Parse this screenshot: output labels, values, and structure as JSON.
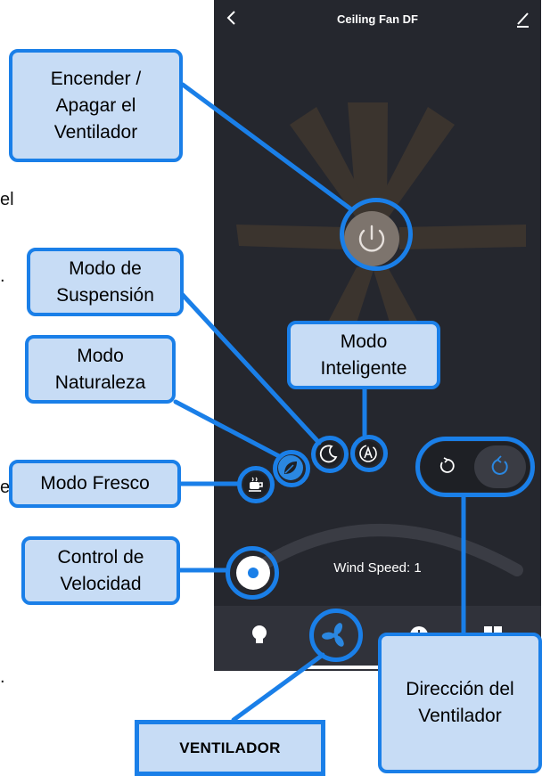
{
  "app": {
    "title": "Ceiling Fan DF",
    "wind_speed_text": "Wind Speed: 1"
  },
  "page_edge_fragments": {
    "el": "el",
    "dot": ".",
    "e": "e",
    "dot2": "."
  },
  "callouts": {
    "power": [
      "Encender /",
      "Apagar el",
      "Ventilador"
    ],
    "sleep": [
      "Modo de",
      "Suspensión"
    ],
    "smart": [
      "Modo",
      "Inteligente"
    ],
    "nature": [
      "Modo",
      "Naturaleza"
    ],
    "fresh": [
      "Modo Fresco"
    ],
    "speed": [
      "Control de",
      "Velocidad"
    ],
    "direction": [
      "Dirección del",
      "Ventilador"
    ],
    "fan_tab": "VENTILADOR"
  },
  "icons": {
    "back": "chevron-left-icon",
    "edit": "pencil-icon",
    "power": "power-icon",
    "coffee": "coffee-icon",
    "leaf": "leaf-icon",
    "moon": "moon-icon",
    "auto": "auto-mode-icon",
    "rotate_ccw": "rotate-counterclockwise-icon",
    "rotate_cw": "rotate-clockwise-icon",
    "bulb": "lightbulb-icon",
    "fan": "fan-icon",
    "clock": "clock-icon",
    "grid": "grid-icon"
  },
  "colors": {
    "app_bg": "#25272e",
    "highlight": "#1a7fe8",
    "callout_fill": "#c7dcf5",
    "active_blue": "#2b87e0",
    "fan_blades": "#3b342e"
  },
  "wind_speed": {
    "level": 1
  },
  "tabs": [
    "lightbulb",
    "fan",
    "timer",
    "more"
  ],
  "active_tab": "fan"
}
